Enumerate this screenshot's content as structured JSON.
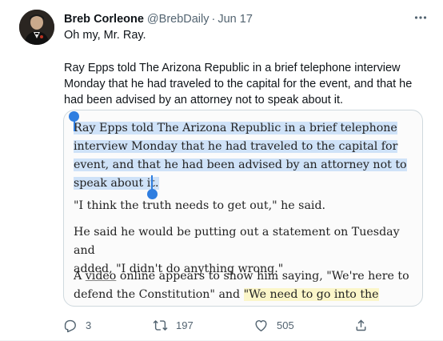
{
  "tweet": {
    "author_name": "Breb Corleone",
    "handle": "@BrebDaily",
    "separator": "·",
    "date": "Jun 17",
    "more_icon": "more-horizontal-icon",
    "text_line1": "Oh my, Mr. Ray.",
    "text_para": "Ray Epps told The Arizona Republic in a brief telephone interview Monday that he had traveled to the capital for the event, and that he had been advised by an attorney not to speak about it."
  },
  "media": {
    "para1_lines": [
      "Ray Epps told The Arizona Republic in a brief telephone",
      "interview Monday that he had traveled to the capital for the",
      "event, and that he had been advised by an attorney not to",
      "speak about it."
    ],
    "para2": "\"I think the truth needs to get out,\" he said.",
    "para3_lines": [
      "He said he would be putting out a statement on Tuesday and",
      "added, \"I didn't do anything wrong.\""
    ],
    "para4_line1_pre": "A ",
    "para4_link": "video",
    "para4_line1_post": " online appears to show him saying, \"We're here to",
    "para4_line2_pre": "defend the Constitution\" and ",
    "para4_quote": "\"We need to go into the Capitol.\"",
    "selection_color": "#cfe2f8",
    "highlight_color": "#fbf6c9",
    "handle_color": "#2f7ee0"
  },
  "actions": {
    "reply_count": "3",
    "retweet_count": "197",
    "like_count": "505",
    "reply_icon": "reply-icon",
    "retweet_icon": "retweet-icon",
    "like_icon": "heart-icon",
    "share_icon": "share-icon"
  },
  "colors": {
    "text_primary": "#0f1419",
    "text_secondary": "#536471",
    "border": "#cfd9de"
  }
}
